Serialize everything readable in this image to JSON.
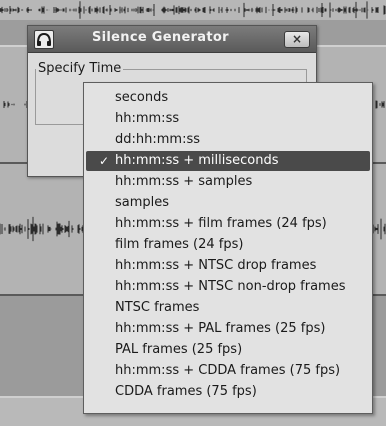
{
  "dialog": {
    "title": "Silence Generator",
    "close_label": "×",
    "section_label": "Specify Time"
  },
  "menu": {
    "selected_index": 3,
    "check_mark": "✓",
    "items": [
      "seconds",
      "hh:mm:ss",
      "dd:hh:mm:ss",
      "hh:mm:ss + milliseconds",
      "hh:mm:ss + samples",
      "samples",
      "hh:mm:ss + film frames (24 fps)",
      "film frames (24 fps)",
      "hh:mm:ss + NTSC drop frames",
      "hh:mm:ss + NTSC non-drop frames",
      "NTSC frames",
      "hh:mm:ss + PAL frames (25 fps)",
      "PAL frames (25 fps)",
      "hh:mm:ss + CDDA frames (75 fps)",
      "CDDA frames (75 fps)"
    ]
  },
  "icons": {
    "dialog_icon": "audacity-headphones-icon",
    "close_icon": "close-icon",
    "check_icon": "checkmark-icon"
  },
  "colors": {
    "menu_bg": "#e2e2e2",
    "selected_bg": "#4a4a4a",
    "titlebar_bg": "#6a6a6a"
  }
}
